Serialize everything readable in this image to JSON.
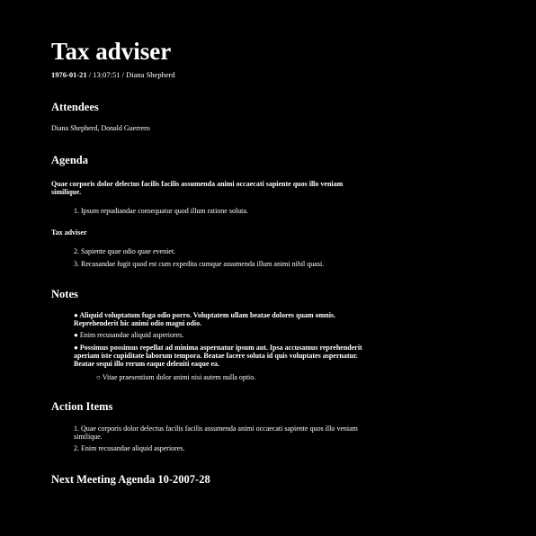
{
  "title": "Tax adviser",
  "meta": {
    "date": "1976-01-21",
    "time": "13:07:51",
    "author": "Diana Shepherd"
  },
  "attendees": {
    "heading": "Attendees",
    "text": "Diana Shepherd, Donald Guerrero"
  },
  "agenda": {
    "heading": "Agenda",
    "intro": "Quae corporis dolor delectus facilis facilis assumenda animi occaecati sapiente quos illo veniam similique.",
    "items_a": [
      "1. Ipsum repudiandae consequatur quod illum ratione soluta."
    ],
    "subheading": "Tax adviser",
    "items_b": [
      "2. Sapiente quae odio quae eveniet.",
      "3. Recusandae fugit quod est cum expedita cumque assumenda illum animi nihil quasi."
    ]
  },
  "notes": {
    "heading": "Notes",
    "items": [
      "● Aliquid voluptatum fuga odio porro. Voluptatem ullam beatae dolores quam omnis. Reprehenderit hic animi odio magni odio.",
      "● Enim recusandae aliquid asperiores.",
      "● Possimus possimus repellat ad minima aspernatur ipsum aut. Ipsa accusamus reprehenderit aperiam iste cupiditate laborum tempora. Beatae facere soluta id quis voluptates aspernatur. Beatae sequi illo rerum eaque deleniti eaque ea."
    ],
    "subitem": "○ Vitae praesentium dolor animi nisi autem nulla optio."
  },
  "action_items": {
    "heading": "Action Items",
    "items": [
      "1. Quae corporis dolor delectus facilis facilis assumenda animi occaecati sapiente quos illo veniam similique.",
      "2. Enim recusandae aliquid asperiores."
    ]
  },
  "next_meeting": {
    "heading": "Next Meeting Agenda 10-2007-28"
  }
}
